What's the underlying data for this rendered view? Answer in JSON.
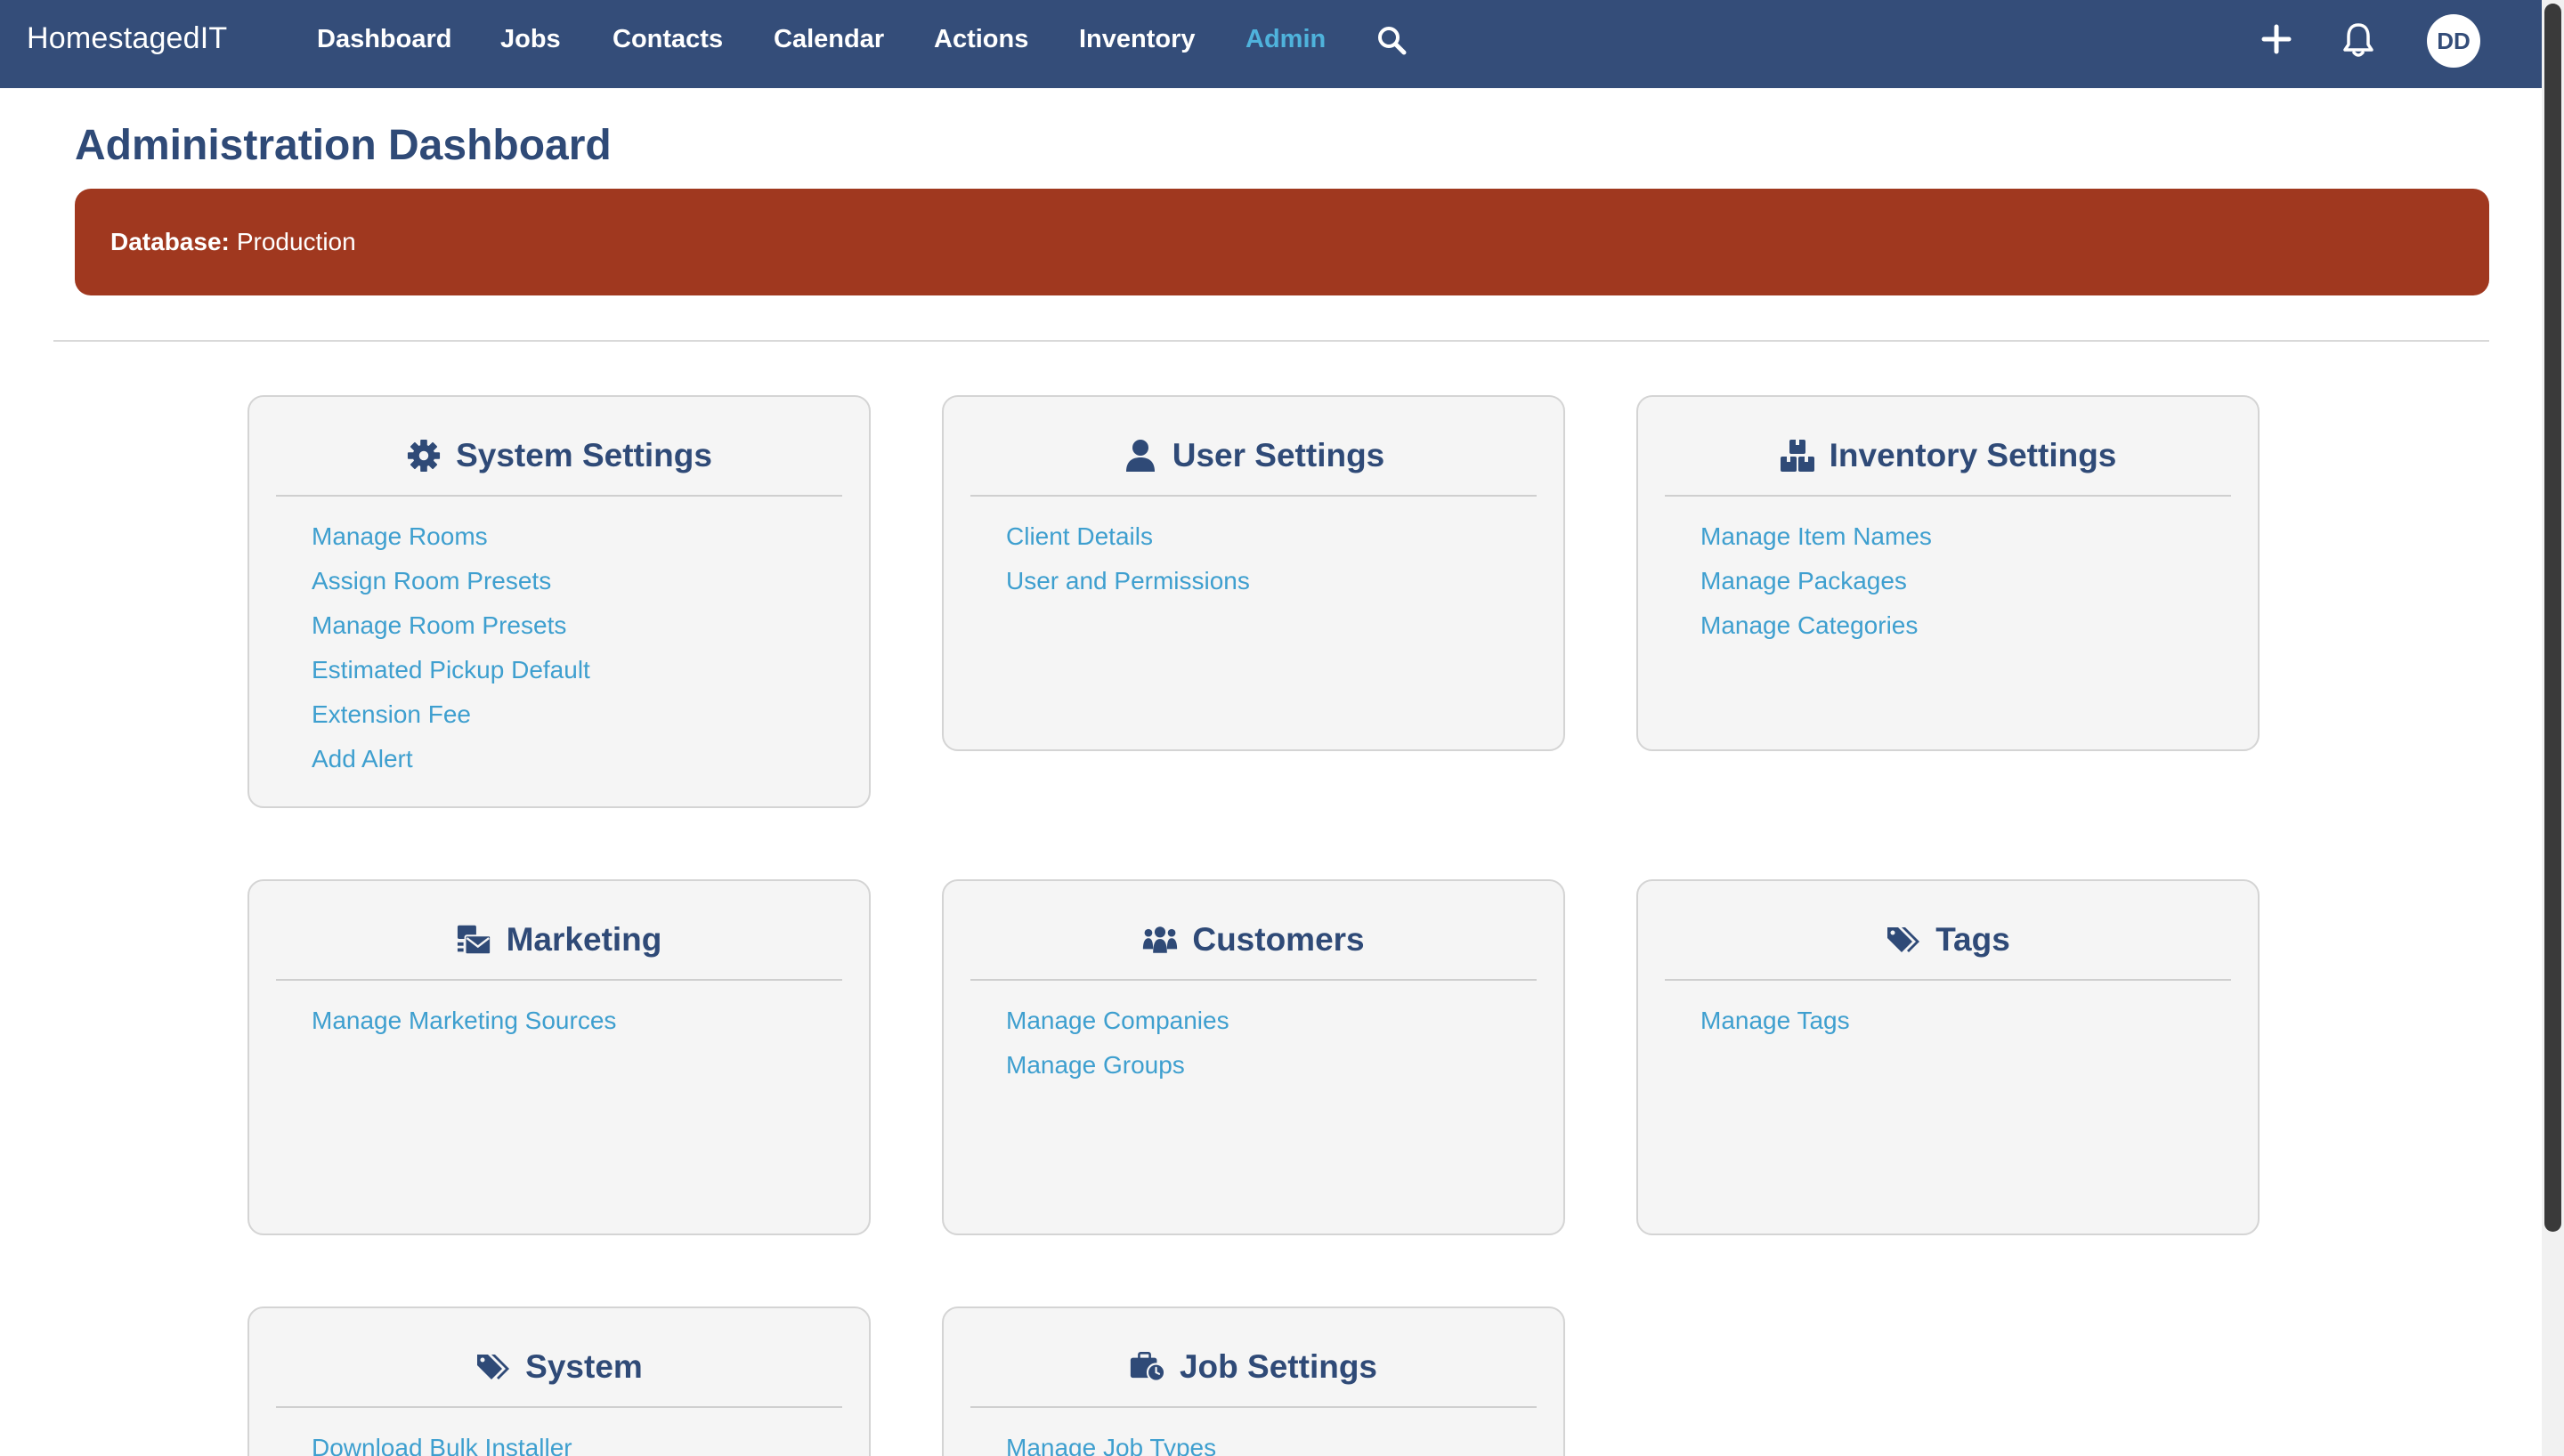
{
  "app": {
    "brand": "HomestagedIT"
  },
  "nav": {
    "items": [
      {
        "label": "Dashboard"
      },
      {
        "label": "Jobs"
      },
      {
        "label": "Contacts"
      },
      {
        "label": "Calendar"
      },
      {
        "label": "Actions"
      },
      {
        "label": "Inventory"
      },
      {
        "label": "Admin",
        "active": true
      }
    ],
    "icons": [
      "search-icon",
      "plus-icon",
      "bell-icon"
    ],
    "avatar_initials": "DD"
  },
  "page": {
    "title": "Administration Dashboard",
    "database_label": "Database:",
    "database_value": "Production",
    "banner_color": "#a0381f",
    "accent_color": "#344d79",
    "link_color": "#3e9fcf"
  },
  "cards": {
    "system_settings": {
      "title": "System Settings",
      "icon": "gear-icon",
      "links": [
        "Manage Rooms",
        "Assign Room Presets",
        "Manage Room Presets",
        "Estimated Pickup Default",
        "Extension Fee",
        "Add Alert"
      ]
    },
    "user_settings": {
      "title": "User Settings",
      "icon": "user-icon",
      "links": [
        "Client Details",
        "User and Permissions"
      ]
    },
    "inventory_settings": {
      "title": "Inventory Settings",
      "icon": "boxes-icon",
      "links": [
        "Manage Item Names",
        "Manage Packages",
        "Manage Categories"
      ]
    },
    "marketing": {
      "title": "Marketing",
      "icon": "mail-bulk-icon",
      "links": [
        "Manage Marketing Sources"
      ]
    },
    "customers": {
      "title": "Customers",
      "icon": "users-icon",
      "links": [
        "Manage Companies",
        "Manage Groups"
      ]
    },
    "tags": {
      "title": "Tags",
      "icon": "tags-icon",
      "links": [
        "Manage Tags"
      ]
    },
    "system": {
      "title": "System",
      "icon": "tags-icon",
      "links": [
        "Download Bulk Installer"
      ]
    },
    "job_settings": {
      "title": "Job Settings",
      "icon": "briefcase-clock-icon",
      "links": [
        "Manage Job Types"
      ]
    }
  }
}
